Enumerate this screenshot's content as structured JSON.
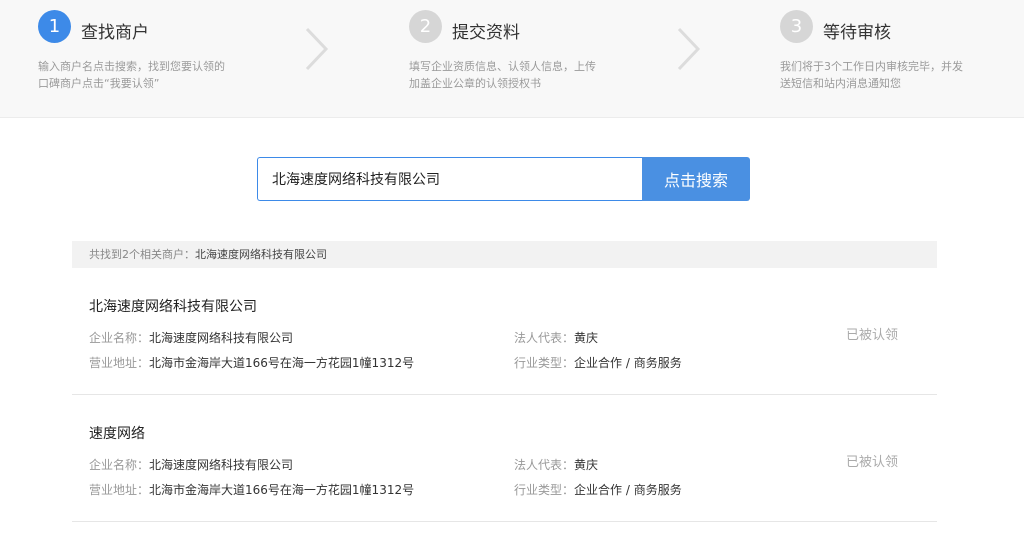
{
  "colors": {
    "accent": "#3d8ae8",
    "button": "#4a90e2",
    "step_inactive": "#d6d6d6",
    "arrow": "#dcdcdc"
  },
  "steps": [
    {
      "num": "1",
      "title": "查找商户",
      "desc_line1": "输入商户名点击搜索，找到您要认领的",
      "desc_line2": "口碑商户点击“我要认领”"
    },
    {
      "num": "2",
      "title": "提交资料",
      "desc_line1": "填写企业资质信息、认领人信息，上传",
      "desc_line2": "加盖企业公章的认领授权书"
    },
    {
      "num": "3",
      "title": "等待审核",
      "desc_line1": "我们将于3个工作日内审核完毕，并发",
      "desc_line2": "送短信和站内消息通知您"
    }
  ],
  "search": {
    "value": "北海速度网络科技有限公司",
    "placeholder": "",
    "button_label": "点击搜索"
  },
  "summary": {
    "prefix": "共找到2个相关商户：",
    "keyword": "北海速度网络科技有限公司"
  },
  "results": [
    {
      "title": "北海速度网络科技有限公司",
      "company_label": "企业名称：",
      "company": "北海速度网络科技有限公司",
      "address_label": "营业地址：",
      "address": "北海市金海岸大道166号在海一方花园1幢1312号",
      "legal_label": "法人代表：",
      "legal": "黄庆",
      "industry_label": "行业类型：",
      "industry": "企业合作 / 商务服务",
      "status": "已被认领"
    },
    {
      "title": "速度网络",
      "company_label": "企业名称：",
      "company": "北海速度网络科技有限公司",
      "address_label": "营业地址：",
      "address": "北海市金海岸大道166号在海一方花园1幢1312号",
      "legal_label": "法人代表：",
      "legal": "黄庆",
      "industry_label": "行业类型：",
      "industry": "企业合作 / 商务服务",
      "status": "已被认领"
    }
  ]
}
